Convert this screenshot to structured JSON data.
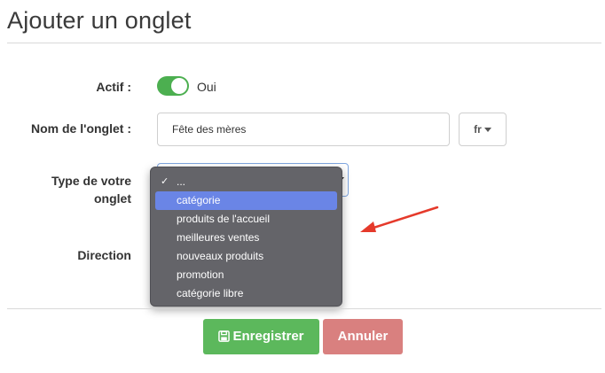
{
  "page": {
    "title": "Ajouter un onglet"
  },
  "form": {
    "actif_label": "Actif :",
    "actif_value": "Oui",
    "name_label": "Nom de l'onglet :",
    "name_value": "Fête des mères",
    "lang_label": "fr",
    "type_label_line1": "Type de votre",
    "type_label_line2": "onglet",
    "direction_label": "Direction"
  },
  "dropdown": {
    "options": [
      {
        "label": "...",
        "checked": true
      },
      {
        "label": "catégorie",
        "highlighted": true
      },
      {
        "label": "produits de l'accueil"
      },
      {
        "label": "meilleures ventes"
      },
      {
        "label": "nouveaux produits"
      },
      {
        "label": "promotion"
      },
      {
        "label": "catégorie libre"
      }
    ]
  },
  "buttons": {
    "save": "Enregistrer",
    "cancel": "Annuler"
  },
  "colors": {
    "toggle_on": "#4caf50",
    "dropdown_bg": "#646469",
    "highlight": "#6a85e6",
    "save": "#5cb85c",
    "cancel": "#d9807f",
    "arrow": "#e53a2b"
  },
  "icons": {
    "save": "floppy-disk-icon",
    "check": "check-icon",
    "caret": "caret-down-icon",
    "arrow": "red-arrow-icon"
  }
}
